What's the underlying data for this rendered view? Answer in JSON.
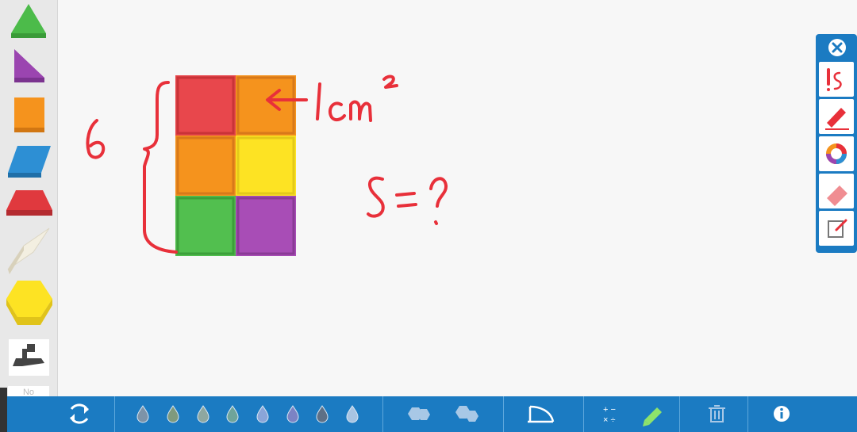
{
  "palette": {
    "shapes": [
      {
        "name": "triangle",
        "color": "#4cbb4a"
      },
      {
        "name": "right-triangle",
        "color": "#9b45b0"
      },
      {
        "name": "square",
        "color": "#f5931d"
      },
      {
        "name": "parallelogram",
        "color": "#2d8fd4"
      },
      {
        "name": "trapezoid",
        "color": "#e0393e"
      },
      {
        "name": "rhombus",
        "color": "#f3efe1"
      },
      {
        "name": "hexagon",
        "color": "#fde323"
      }
    ],
    "pattern_label": "No"
  },
  "grid": {
    "tiles": [
      {
        "color": "#e8474c"
      },
      {
        "color": "#f5931d"
      },
      {
        "color": "#f5931d"
      },
      {
        "color": "#fde323"
      },
      {
        "color": "#52bf4f"
      },
      {
        "color": "#a84db6"
      }
    ]
  },
  "annotations": {
    "side_count": "6",
    "unit_label": "1cm²",
    "area_question": "S = ?",
    "ink_color": "#e8303a"
  },
  "tool_panel": {
    "tools": [
      "pen-tool",
      "highlighter-tool",
      "color-picker",
      "eraser-tool",
      "notes-tool"
    ]
  },
  "bottom_bar": {
    "drop_colors": [
      "#7d93a8",
      "#7f9a7d",
      "#8ea7a0",
      "#6fa49a",
      "#8aa5d8",
      "#7b83c4",
      "#5e7086",
      "#a8c4e2"
    ]
  }
}
